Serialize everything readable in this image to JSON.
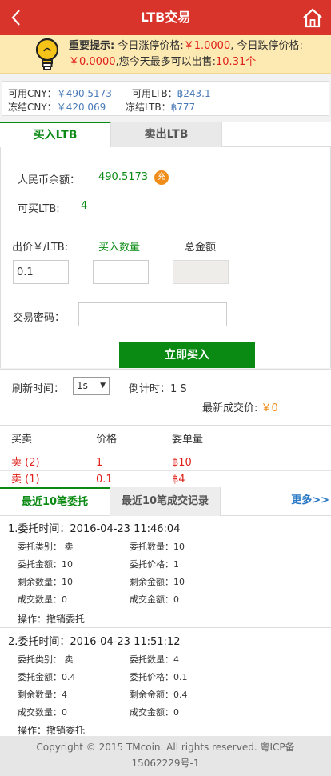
{
  "header": {
    "title": "LTB交易",
    "back_icon": "chevron-left-icon",
    "home_icon": "home-icon"
  },
  "notice": {
    "label": "重要提示:",
    "limit_up_text": "今日涨停价格:",
    "limit_up_value": "￥1.0000",
    "limit_down_text": ", 今日跌停价格:",
    "limit_down_value": "￥0.0000",
    "max_sell_text": ",您今天最多可以出售:",
    "max_sell_value": "10.31个"
  },
  "balances": {
    "cny_available_label": "可用CNY：",
    "cny_available_value": "￥490.5173",
    "ltb_available_label": "可用LTB：",
    "ltb_available_value": "฿243.1",
    "cny_frozen_label": "冻结CNY：",
    "cny_frozen_value": "￥420.069",
    "ltb_frozen_label": "冻结LTB：",
    "ltb_frozen_value": "฿777"
  },
  "tabs": {
    "buy": "买入LTB",
    "sell": "卖出LTB"
  },
  "form": {
    "cny_balance_label": "人民币余额：",
    "cny_balance_value": "490.5173",
    "recharge_badge": "充",
    "can_buy_label": "可买LTB:",
    "can_buy_value": "4",
    "price_label": "出价￥/LTB:",
    "quantity_label": "买入数量",
    "total_label": "总金额",
    "price_value": "0.1",
    "quantity_value": "",
    "total_value": "",
    "password_label": "交易密码：",
    "password_value": "",
    "submit": "立即买入"
  },
  "refresh": {
    "label": "刷新时间：",
    "interval": "1s",
    "countdown_label": "倒计时：",
    "countdown_value": "1 S",
    "last_price_label": "最新成交价:",
    "last_price_value": "￥0"
  },
  "trades": {
    "headers": [
      "买卖",
      "价格",
      "委单量"
    ],
    "rows": [
      {
        "side": "卖 (2)",
        "price": "1",
        "amount": "฿10"
      },
      {
        "side": "卖 (1)",
        "price": "0.1",
        "amount": "฿4"
      }
    ]
  },
  "order_tabs": {
    "recent_orders": "最近10笔委托",
    "recent_trades": "最近10笔成交记录",
    "more": "更多>>"
  },
  "orders": [
    {
      "time": "1.委托时间：2016-04-23 11:46:04",
      "type": "委托类别： 卖",
      "qty": "委托数量：10",
      "amount": "委托金额：10",
      "price": "委托价格：1",
      "remain_qty": "剩余数量：10",
      "remain_amount": "剩余金额：10",
      "deal_qty": "成交数量：0",
      "deal_amount": "成交金额：0",
      "op_label": "操作：",
      "op_action": "撤销委托"
    },
    {
      "time": "2.委托时间：2016-04-23 11:51:12",
      "type": "委托类别： 卖",
      "qty": "委托数量：4",
      "amount": "委托金额：0.4",
      "price": "委托价格：0.1",
      "remain_qty": "剩余数量：4",
      "remain_amount": "剩余金额：0.4",
      "deal_qty": "成交数量：0",
      "deal_amount": "成交金额：0",
      "op_label": "操作：",
      "op_action": "撤销委托"
    }
  ],
  "footer": {
    "line1": "Copyright © 2015 TMcoin. All rights reserved. 粤ICP备",
    "line2": "15062229号-1"
  },
  "colors": {
    "brand_red": "#d9342b",
    "buy_green": "#0a8a13",
    "sell_red": "#e0211a",
    "notice_bg": "#fde9b2",
    "link_blue": "#2a78c4"
  }
}
